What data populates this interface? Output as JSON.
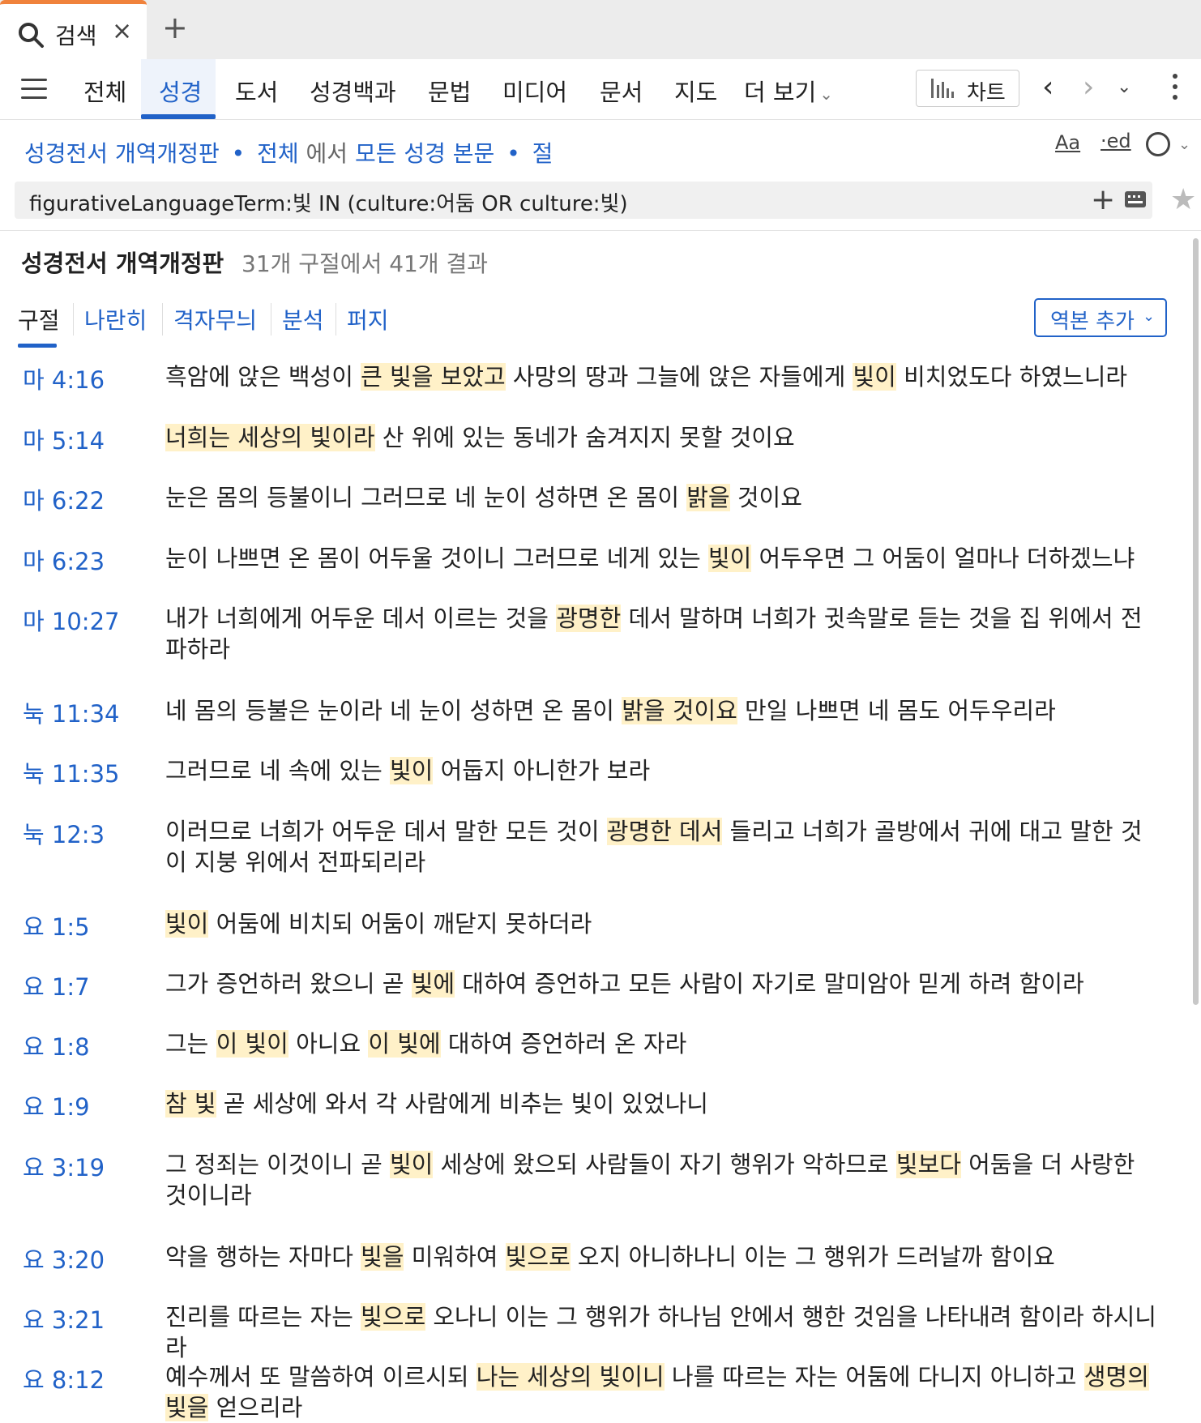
{
  "tab": {
    "label": "검색",
    "close": "×",
    "new_tab": "+"
  },
  "nav": {
    "items": [
      "전체",
      "성경",
      "도서",
      "성경백과",
      "문법",
      "미디어",
      "문서",
      "지도",
      "더 보기"
    ],
    "more_chevron": "⌄",
    "chart_label": "차트",
    "back": "‹",
    "forward": "›",
    "history": "⌄"
  },
  "scope": {
    "version": "성경전서 개역개정판",
    "dot1": "•",
    "range": "전체",
    "in": "에서",
    "content": "모든 성경 본문",
    "dot2": "•",
    "unit": "절"
  },
  "tools": {
    "font": "Aa",
    "ed": "·ed",
    "chev": "⌄"
  },
  "query": {
    "text": "figurativeLanguageTerm:빛 IN (culture:어둠 OR culture:빛)",
    "plus": "+",
    "star": "★"
  },
  "results": {
    "title": "성경전서 개역개정판",
    "count": "31개 구절에서 41개 결과",
    "subtabs": [
      "구절",
      "나란히",
      "격자무늬",
      "분석",
      "퍼지"
    ],
    "add_version": "역본 추가",
    "add_version_chev": "⌄"
  },
  "verses": [
    {
      "ref": "마 4:16",
      "segments": [
        {
          "t": "흑암에 앉은 백성이 "
        },
        {
          "t": "큰 빛을 보았고",
          "h": 1
        },
        {
          "t": " 사망의 땅과 그늘에 앉은 자들에게 "
        },
        {
          "t": "빛이",
          "h": 1
        },
        {
          "t": " 비치었도다 하였느니라"
        }
      ]
    },
    {
      "ref": "마 5:14",
      "segments": [
        {
          "t": "너희는 세상의 빛이라",
          "h": 1
        },
        {
          "t": " 산 위에 있는 동네가 숨겨지지 못할 것이요"
        }
      ]
    },
    {
      "ref": "마 6:22",
      "segments": [
        {
          "t": "눈은 몸의 등불이니 그러므로 네 눈이 성하면 온 몸이 "
        },
        {
          "t": "밝을",
          "h": 1
        },
        {
          "t": " 것이요"
        }
      ]
    },
    {
      "ref": "마 6:23",
      "segments": [
        {
          "t": "눈이 나쁘면 온 몸이 어두울 것이니 그러므로 네게 있는 "
        },
        {
          "t": "빛이",
          "h": 1
        },
        {
          "t": " 어두우면 그 어둠이 얼마나 더하겠느냐"
        }
      ]
    },
    {
      "ref": "마 10:27",
      "segments": [
        {
          "t": "내가 너희에게 어두운 데서 이르는 것을 "
        },
        {
          "t": "광명한",
          "h": 1
        },
        {
          "t": " 데서 말하며 너희가 귓속말로 듣는 것을 집 위에서 전파하라"
        }
      ]
    },
    {
      "ref": "눅 11:34",
      "segments": [
        {
          "t": "네 몸의 등불은 눈이라 네 눈이 성하면 온 몸이 "
        },
        {
          "t": "밝을 것이요",
          "h": 1
        },
        {
          "t": " 만일 나쁘면 네 몸도 어두우리라"
        }
      ]
    },
    {
      "ref": "눅 11:35",
      "segments": [
        {
          "t": "그러므로 네 속에 있는 "
        },
        {
          "t": "빛이",
          "h": 1
        },
        {
          "t": " 어둡지 아니한가 보라"
        }
      ]
    },
    {
      "ref": "눅 12:3",
      "segments": [
        {
          "t": "이러므로 너희가 어두운 데서 말한 모든 것이 "
        },
        {
          "t": "광명한 데서",
          "h": 1
        },
        {
          "t": " 들리고 너희가 골방에서 귀에 대고 말한 것이 지붕 위에서 전파되리라"
        }
      ]
    },
    {
      "ref": "요 1:5",
      "segments": [
        {
          "t": "빛이",
          "h": 1
        },
        {
          "t": " 어둠에 비치되 어둠이 깨닫지 못하더라"
        }
      ]
    },
    {
      "ref": "요 1:7",
      "segments": [
        {
          "t": "그가 증언하러 왔으니 곧 "
        },
        {
          "t": "빛에",
          "h": 1
        },
        {
          "t": " 대하여 증언하고 모든 사람이 자기로 말미암아 믿게 하려 함이라"
        }
      ]
    },
    {
      "ref": "요 1:8",
      "segments": [
        {
          "t": "그는 "
        },
        {
          "t": "이 빛이",
          "h": 1
        },
        {
          "t": " 아니요 "
        },
        {
          "t": "이 빛에",
          "h": 1
        },
        {
          "t": " 대하여 증언하러 온 자라"
        }
      ]
    },
    {
      "ref": "요 1:9",
      "segments": [
        {
          "t": "참 빛",
          "h": 1
        },
        {
          "t": " 곧 세상에 와서 각 사람에게 비추는 빛이 있었나니"
        }
      ]
    },
    {
      "ref": "요 3:19",
      "segments": [
        {
          "t": "그 정죄는 이것이니 곧 "
        },
        {
          "t": "빛이",
          "h": 1
        },
        {
          "t": " 세상에 왔으되 사람들이 자기 행위가 악하므로 "
        },
        {
          "t": "빛보다",
          "h": 1
        },
        {
          "t": " 어둠을 더 사랑한 것이니라"
        }
      ]
    },
    {
      "ref": "요 3:20",
      "segments": [
        {
          "t": "악을 행하는 자마다 "
        },
        {
          "t": "빛을",
          "h": 1
        },
        {
          "t": " 미워하여 "
        },
        {
          "t": "빛으로",
          "h": 1
        },
        {
          "t": " 오지 아니하나니 이는 그 행위가 드러날까 함이요"
        }
      ]
    },
    {
      "ref": "요 3:21",
      "segments": [
        {
          "t": "진리를 따르는 자는 "
        },
        {
          "t": "빛으로",
          "h": 1
        },
        {
          "t": " 오나니 이는 그 행위가 하나님 안에서 행한 것임을 나타내려 함이라 하시니라"
        }
      ]
    },
    {
      "ref": "요 8:12",
      "segments": [
        {
          "t": "예수께서 또 말씀하여 이르시되 "
        },
        {
          "t": "나는 세상의 빛이니",
          "h": 1
        },
        {
          "t": " 나를 따르는 자는 어둠에 다니지 아니하고 "
        },
        {
          "t": "생명의 빛을",
          "h": 1
        },
        {
          "t": " 얻으리라"
        }
      ]
    }
  ]
}
